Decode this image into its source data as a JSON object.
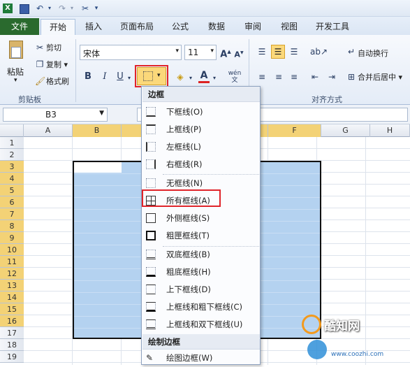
{
  "qat": {
    "undo": "↶",
    "redo": "↷"
  },
  "tabs": [
    "文件",
    "开始",
    "插入",
    "页面布局",
    "公式",
    "数据",
    "审阅",
    "视图",
    "开发工具"
  ],
  "ribbon": {
    "paste": "粘贴",
    "cut": "剪切",
    "copy": "复制 ▾",
    "format_painter": "格式刷",
    "clipboard_label": "剪贴板",
    "font_name": "宋体",
    "font_size": "11",
    "bold": "B",
    "italic": "I",
    "underline": "U",
    "wrap_text": "自动换行",
    "merge_center": "合并后居中 ▾",
    "align_label": "对齐方式",
    "wen": "wén"
  },
  "formula_bar": {
    "name_box": "B3"
  },
  "columns": [
    "A",
    "B",
    "C",
    "D",
    "E",
    "F",
    "G",
    "H"
  ],
  "rows": [
    "1",
    "2",
    "3",
    "4",
    "5",
    "6",
    "7",
    "8",
    "9",
    "10",
    "11",
    "12",
    "13",
    "14",
    "15",
    "16",
    "17",
    "18",
    "19"
  ],
  "menu": {
    "header_borders": "边框",
    "items": [
      "下框线(O)",
      "上框线(P)",
      "左框线(L)",
      "右框线(R)",
      "无框线(N)",
      "所有框线(A)",
      "外侧框线(S)",
      "粗匣框线(T)",
      "双底框线(B)",
      "粗底框线(H)",
      "上下框线(D)",
      "上框线和粗下框线(C)",
      "上框线和双下框线(U)"
    ],
    "header_draw": "绘制边框",
    "draw_item": "绘图边框(W)"
  },
  "watermark": {
    "brand": "酷知网",
    "site": "www.coozhi.com"
  },
  "colors": {
    "selection": "#b4d2f0",
    "highlight": "#e0242a",
    "file_tab": "#2a6a2e"
  }
}
